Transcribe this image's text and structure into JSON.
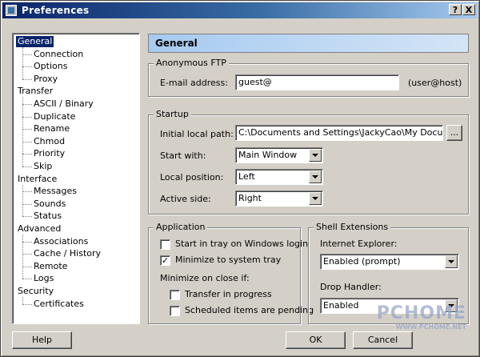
{
  "window": {
    "title": "Preferences",
    "help_btn": "?",
    "close_btn": "X"
  },
  "tree": [
    {
      "label": "General",
      "level": 0,
      "selected": true
    },
    {
      "label": "Connection",
      "level": 1
    },
    {
      "label": "Options",
      "level": 1
    },
    {
      "label": "Proxy",
      "level": 1
    },
    {
      "label": "Transfer",
      "level": 0
    },
    {
      "label": "ASCII / Binary",
      "level": 1
    },
    {
      "label": "Duplicate",
      "level": 1
    },
    {
      "label": "Rename",
      "level": 1
    },
    {
      "label": "Chmod",
      "level": 1
    },
    {
      "label": "Priority",
      "level": 1
    },
    {
      "label": "Skip",
      "level": 1
    },
    {
      "label": "Interface",
      "level": 0
    },
    {
      "label": "Messages",
      "level": 1
    },
    {
      "label": "Sounds",
      "level": 1
    },
    {
      "label": "Status",
      "level": 1
    },
    {
      "label": "Advanced",
      "level": 0
    },
    {
      "label": "Associations",
      "level": 1
    },
    {
      "label": "Cache / History",
      "level": 1
    },
    {
      "label": "Remote",
      "level": 1
    },
    {
      "label": "Logs",
      "level": 1
    },
    {
      "label": "Security",
      "level": 0
    },
    {
      "label": "Certificates",
      "level": 1
    }
  ],
  "header": {
    "title": "General"
  },
  "anon_ftp": {
    "group_label": "Anonymous FTP",
    "email_label": "E-mail address:",
    "email_value": "guest@",
    "hint": "(user@host)"
  },
  "startup": {
    "group_label": "Startup",
    "local_path_label": "Initial local path:",
    "local_path_value": "C:\\Documents and Settings\\JackyCao\\My Documents",
    "browse_label": "...",
    "start_with_label": "Start with:",
    "start_with_value": "Main Window",
    "local_pos_label": "Local position:",
    "local_pos_value": "Left",
    "active_side_label": "Active side:",
    "active_side_value": "Right"
  },
  "application": {
    "group_label": "Application",
    "start_tray_label": "Start in tray on Windows login",
    "start_tray_checked": false,
    "minimize_tray_label": "Minimize to system tray",
    "minimize_tray_checked": true,
    "minimize_close_label": "Minimize on close if:",
    "transfer_progress_label": "Transfer in progress",
    "transfer_progress_checked": false,
    "scheduled_label": "Scheduled items are pending",
    "scheduled_checked": false
  },
  "shell": {
    "group_label": "Shell Extensions",
    "ie_label": "Internet Explorer:",
    "ie_value": "Enabled (prompt)",
    "drop_label": "Drop Handler:",
    "drop_value": "Enabled"
  },
  "buttons": {
    "help": "Help",
    "ok": "OK",
    "cancel": "Cancel"
  },
  "watermark": {
    "big": "PCHOME",
    "small": "WWW.PCHOME.NET"
  }
}
